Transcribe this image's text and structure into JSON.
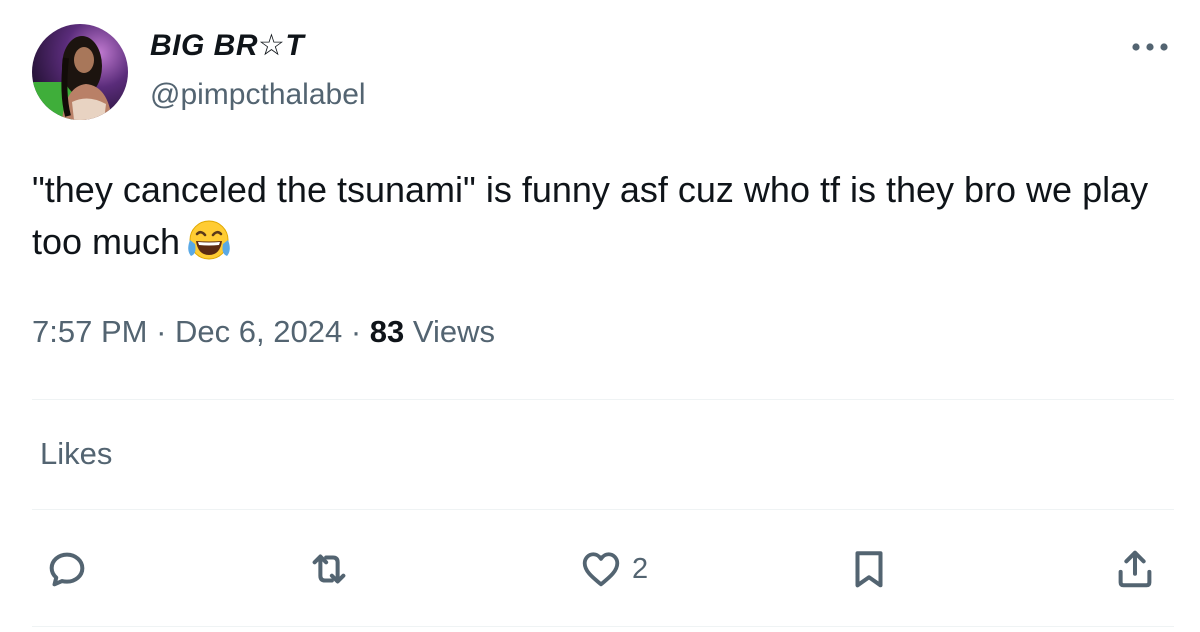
{
  "author": {
    "display_name": "BIG BR☆T",
    "handle": "@pimpcthalabel",
    "avatar_icon": "profile-photo"
  },
  "tweet": {
    "text": "\"they canceled the tsunami\" is funny asf cuz who tf is they bro we play too much",
    "emoji": "face-with-tears-of-joy"
  },
  "meta": {
    "time": "7:57 PM",
    "separator": "·",
    "date": "Dec 6, 2024",
    "views_count": "83",
    "views_label": "Views"
  },
  "likes_link": "Likes",
  "actions": {
    "reply_icon": "reply-icon",
    "retweet_icon": "retweet-icon",
    "like_icon": "heart-icon",
    "like_count": "2",
    "bookmark_icon": "bookmark-icon",
    "share_icon": "share-icon"
  },
  "colors": {
    "text_primary": "#0f1419",
    "text_secondary": "#536471",
    "divider": "#eff3f4"
  }
}
